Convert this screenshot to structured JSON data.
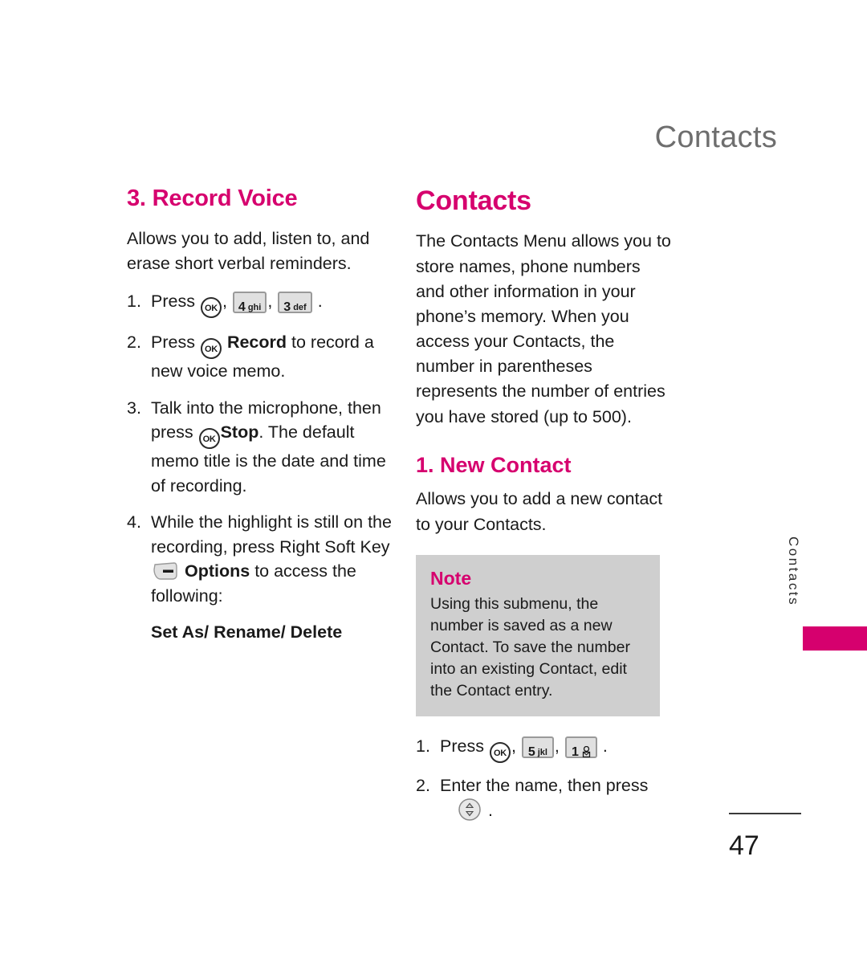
{
  "header": {
    "running_title": "Contacts"
  },
  "accent_colors": {
    "magenta": "#d6006e",
    "header_gray": "#6e6e6e",
    "note_background": "#cfcfcf",
    "key_background": "#e0e0e0"
  },
  "left_column": {
    "section_title": "3. Record Voice",
    "intro": "Allows you to add, listen to, and erase short verbal reminders.",
    "steps": [
      {
        "num": "1.",
        "text_before": "Press",
        "text_after": ".",
        "keys": [
          "ok-key",
          "4-ghi-key",
          "3-def-key"
        ]
      },
      {
        "num": "2.",
        "text_before": "Press",
        "bold_label": "Record",
        "text_after": "to record a new voice memo.",
        "keys": [
          "ok-key"
        ]
      },
      {
        "num": "3.",
        "text_before": "Talk into the microphone, then press",
        "bold_label": "Stop",
        "text_after": ". The default memo title is the date and time of recording.",
        "keys": [
          "ok-key"
        ]
      },
      {
        "num": "4.",
        "text_before": "While the highlight is still on the recording, press Right Soft Key",
        "bold_label": "Options",
        "text_after": "to access the following:",
        "keys": [
          "right-soft-key"
        ]
      }
    ],
    "options_list": "Set As/ Rename/ Delete"
  },
  "right_column": {
    "section_title": "Contacts",
    "intro": "The Contacts Menu allows you to store names, phone numbers and other information in your phone’s memory. When you access your Contacts, the number in parentheses represents the number of entries you have stored (up to 500).",
    "sub_title": "1. New Contact",
    "sub_intro": "Allows you to add a new contact to your Contacts.",
    "note": {
      "title": "Note",
      "body": "Using this submenu, the number is saved as a new Contact. To save the number into an existing Contact, edit the Contact entry."
    },
    "steps": [
      {
        "num": "1.",
        "text_before": "Press",
        "text_after": ".",
        "keys": [
          "ok-key",
          "5-jkl-key",
          "1-voicemail-key"
        ]
      },
      {
        "num": "2.",
        "text_before": "Enter the name, then press",
        "text_after": ".",
        "keys": [
          "navigation-key"
        ]
      }
    ]
  },
  "keys": {
    "ok": "OK",
    "four_digit": "4",
    "four_letters": "ghi",
    "three_digit": "3",
    "three_letters": "def",
    "five_digit": "5",
    "five_letters": "jkl",
    "one_digit": "1"
  },
  "side_tab": {
    "label": "Contacts"
  },
  "footer": {
    "page_number": "47"
  }
}
